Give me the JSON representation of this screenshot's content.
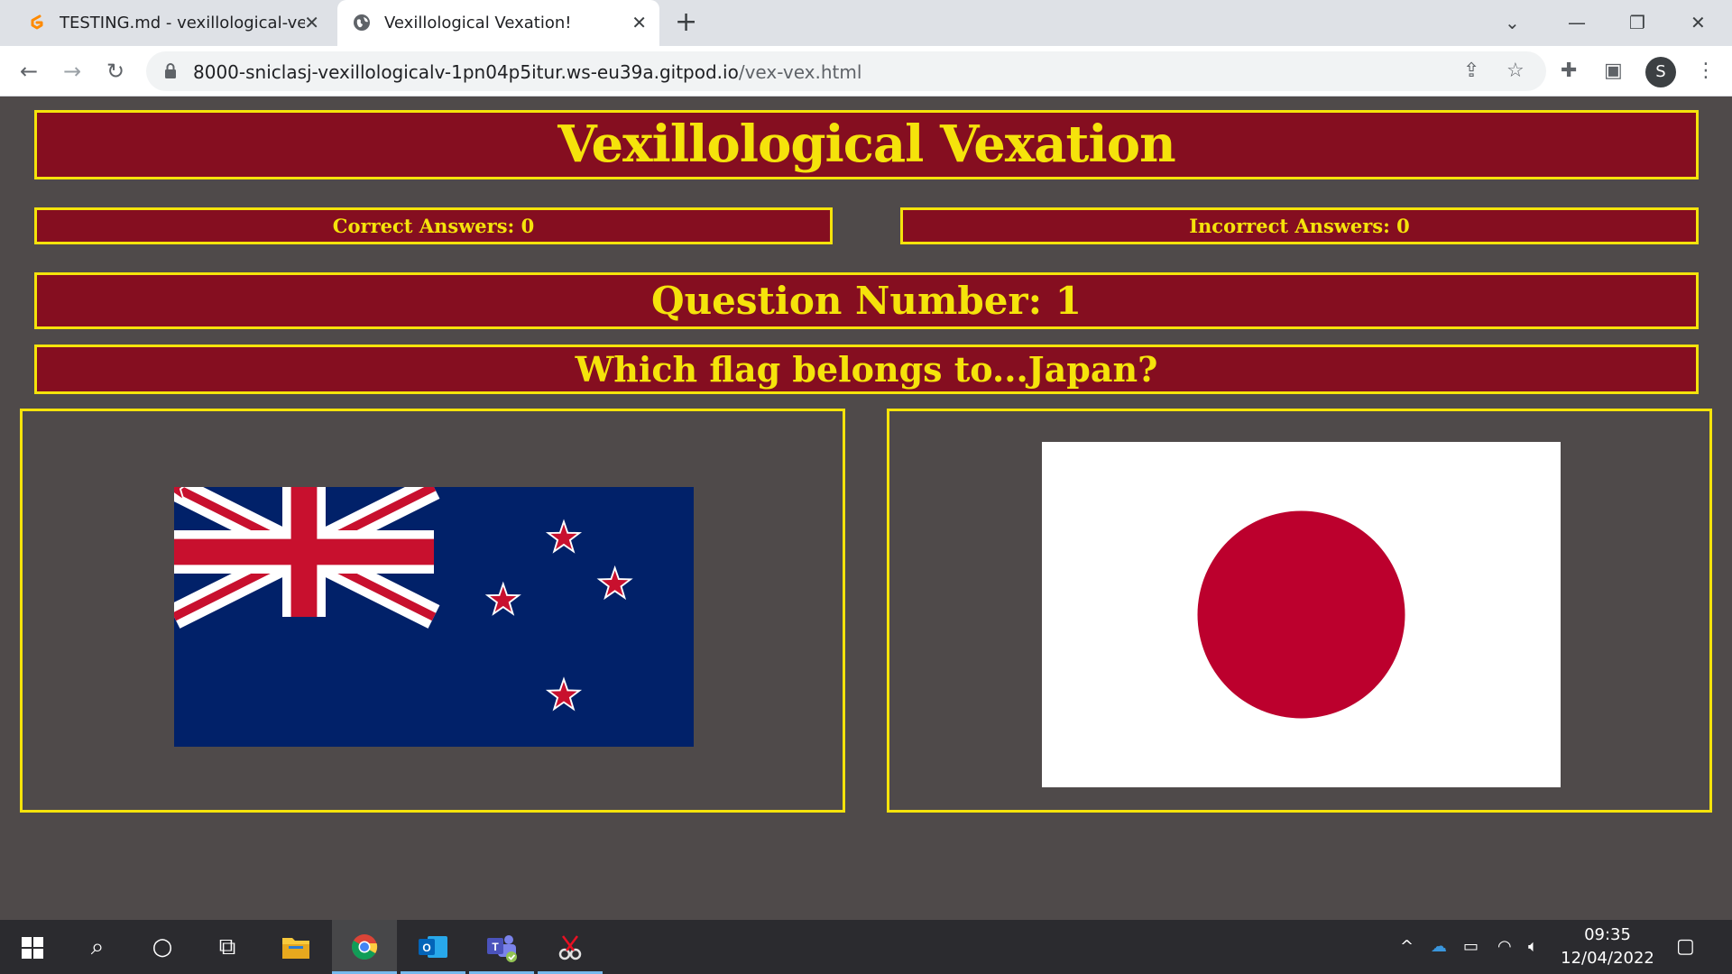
{
  "browser": {
    "tabs": [
      {
        "title": "TESTING.md - vexillological-vexa",
        "active": false
      },
      {
        "title": "Vexillological Vexation!",
        "active": true
      }
    ],
    "url_host": "8000-sniclasj-vexillologicalv-1pn04p5itur.ws-eu39a.gitpod.io",
    "url_path": "/vex-vex.html",
    "profile_initial": "S"
  },
  "page": {
    "title": "Vexillological Vexation",
    "correct_label": "Correct Answers: 0",
    "incorrect_label": "Incorrect Answers: 0",
    "question_number": "Question Number: 1",
    "question": "Which flag belongs to...Japan?",
    "answers": [
      {
        "flag": "New Zealand flag",
        "icon": "flag-new-zealand"
      },
      {
        "flag": "Japan flag",
        "icon": "flag-japan"
      }
    ]
  },
  "colors": {
    "background": "#4f4a4a",
    "banner": "#850e20",
    "accent": "#f5e30b"
  },
  "taskbar": {
    "time": "09:35",
    "date": "12/04/2022"
  }
}
